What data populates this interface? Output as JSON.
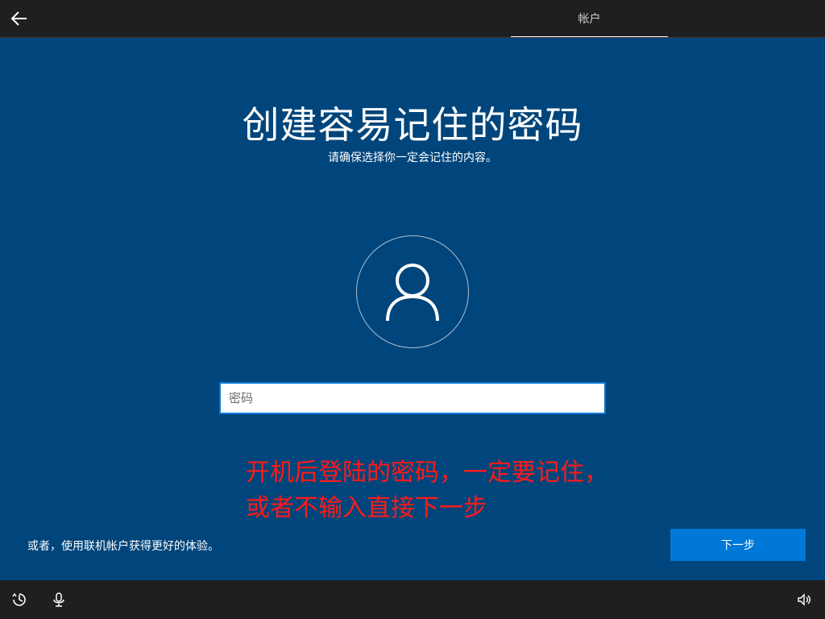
{
  "topbar": {
    "back_icon": "back-arrow-icon",
    "tab_label": "帐户"
  },
  "main": {
    "title": "创建容易记住的密码",
    "subtitle": "请确保选择你一定会记住的内容。",
    "avatar_icon": "user-icon",
    "password_placeholder": "密码",
    "annotation_line1": "开机后登陆的密码，一定要记住，",
    "annotation_line2": "或者不输入直接下一步",
    "online_account_link": "或者，使用联机帐户获得更好的体验。",
    "next_label": "下一步"
  },
  "bottombar": {
    "icons": [
      "ease-of-access-icon",
      "microphone-icon",
      "volume-icon"
    ]
  },
  "colors": {
    "background": "#00457b",
    "bar": "#1f1f1f",
    "accent": "#0078d7",
    "annotation": "#ff1a1a"
  }
}
